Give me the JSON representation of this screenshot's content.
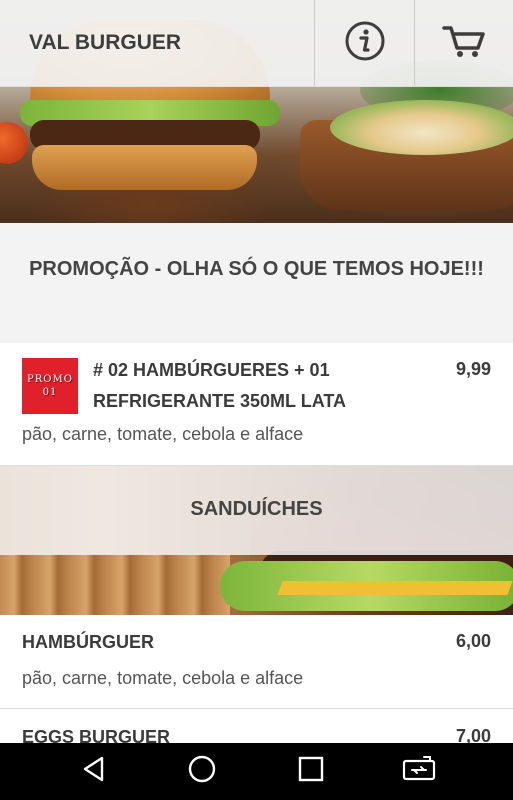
{
  "app": {
    "title": "VAL BURGUER"
  },
  "header": {
    "actions": [
      {
        "icon": "info-icon"
      },
      {
        "icon": "cart-icon"
      }
    ]
  },
  "promo": {
    "heading": "PROMOÇÃO - OLHA SÓ O QUE TEMOS HOJE!!!",
    "item": {
      "badge_line1": "PROMO",
      "badge_line2": "01",
      "name": "# 02 HAMBÚRGUERES + 01 REFRIGERANTE 350ML LATA",
      "price": "9,99",
      "description": "pão, carne, tomate, cebola e alface"
    }
  },
  "sanduiches": {
    "heading": "SANDUÍCHES",
    "items": [
      {
        "name": "HAMBÚRGUER",
        "price": "6,00",
        "description": "pão, carne, tomate, cebola e alface"
      },
      {
        "name": "EGGS BURGUER",
        "price": "7,00"
      }
    ]
  },
  "navbar": {
    "buttons": [
      "back-icon",
      "home-icon",
      "recents-icon",
      "rotate-icon"
    ]
  },
  "colors": {
    "promo_badge": "#e0202a",
    "navbar": "#000000",
    "section_bg": "#f3f3f3"
  }
}
